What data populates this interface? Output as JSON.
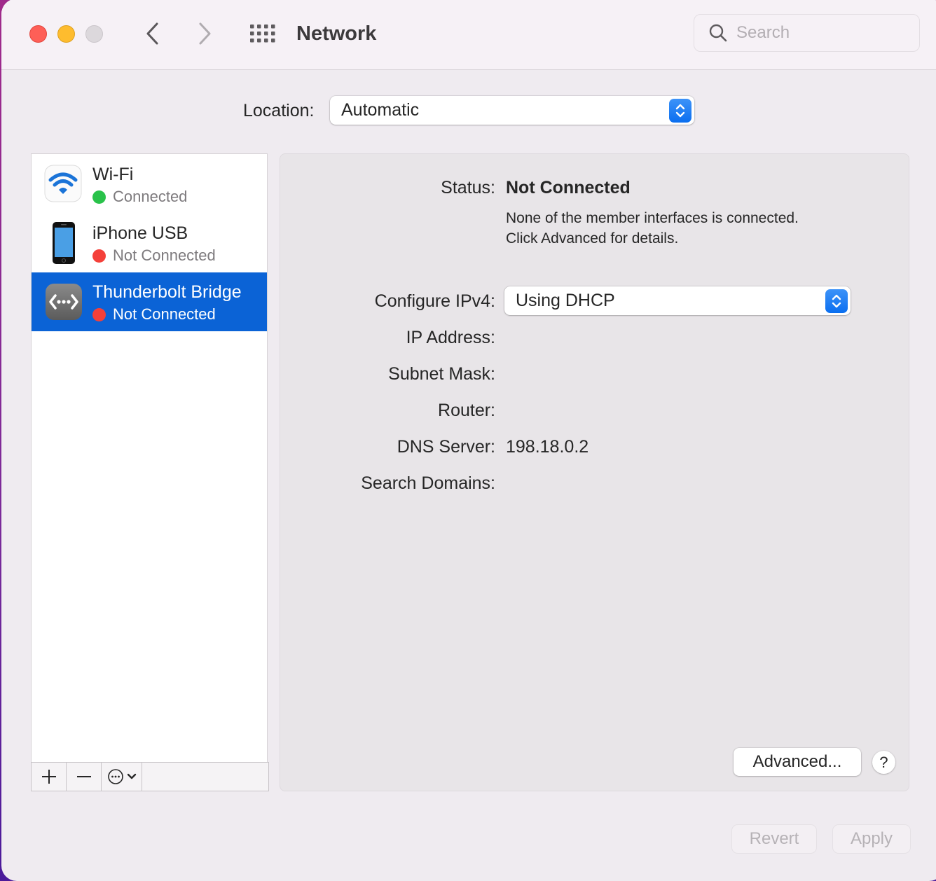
{
  "window": {
    "title": "Network",
    "traffic_lights": {
      "close": "#fe5f57",
      "minimize": "#febc2e",
      "zoom": "#dcd8dc"
    },
    "nav": {
      "back_icon": "chevron-left-icon",
      "forward_icon": "chevron-right-icon",
      "grid_icon": "show-all-grid-icon"
    },
    "search": {
      "placeholder": "Search",
      "value": ""
    }
  },
  "location": {
    "label": "Location:",
    "value": "Automatic"
  },
  "services": [
    {
      "name": "Wi-Fi",
      "status": "Connected",
      "status_color": "#29c24a",
      "icon": "wifi-icon",
      "selected": false
    },
    {
      "name": "iPhone USB",
      "status": "Not Connected",
      "status_color": "#f4403a",
      "icon": "iphone-icon",
      "selected": false
    },
    {
      "name": "Thunderbolt Bridge",
      "status": "Not Connected",
      "status_color": "#f4403a",
      "icon": "thunderbolt-bridge-icon",
      "selected": true
    }
  ],
  "sidebar_toolbar": {
    "add_label": "+",
    "remove_label": "−",
    "action_icon": "ellipsis-circle-icon"
  },
  "detail": {
    "status_label": "Status:",
    "status_value": "Not Connected",
    "status_description_line1": "None of the member interfaces is connected.",
    "status_description_line2": "Click Advanced for details.",
    "configure_ipv4_label": "Configure IPv4:",
    "configure_ipv4_value": "Using DHCP",
    "ip_address_label": "IP Address:",
    "ip_address_value": "",
    "subnet_mask_label": "Subnet Mask:",
    "subnet_mask_value": "",
    "router_label": "Router:",
    "router_value": "",
    "dns_server_label": "DNS Server:",
    "dns_server_value": "198.18.0.2",
    "search_domains_label": "Search Domains:",
    "search_domains_value": "",
    "advanced_button": "Advanced...",
    "help_button": "?"
  },
  "footer": {
    "revert_button": "Revert",
    "apply_button": "Apply"
  },
  "colors": {
    "accent": "#0b63d6",
    "popup_stepper": "#1a7cf5"
  }
}
